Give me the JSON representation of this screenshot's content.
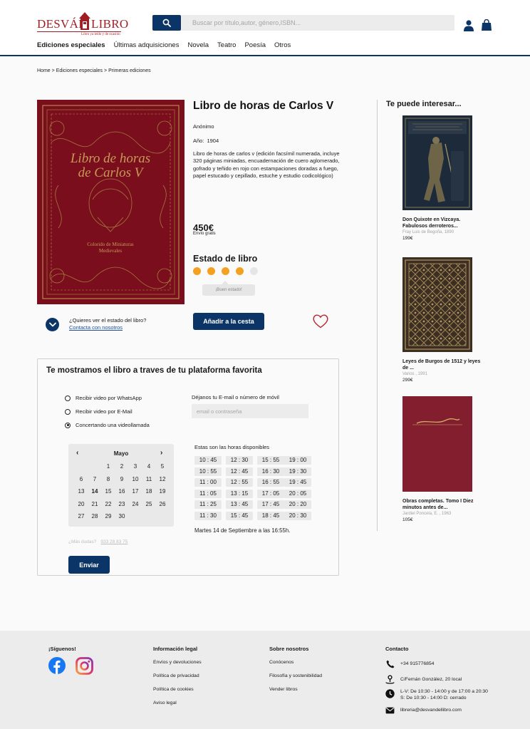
{
  "header": {
    "logo_word1": "DESVÁN",
    "logo_word2": "LIBRO",
    "logo_tagline": "Libro ya leído y de ocasión",
    "search_placeholder": "Buscar por título,autor, género,ISBN...",
    "nav": [
      "Ediciones especiales",
      "Últimas adquisiciones",
      "Novela",
      "Teatro",
      "Poesía",
      "Otros"
    ]
  },
  "breadcrumb": [
    "Home",
    "Ediciones especiales",
    "Primeras ediciones"
  ],
  "product": {
    "title": "Libro de horas de Carlos V",
    "cover_text": [
      "Libro de horas",
      "de Carlos V",
      "Colorido de Miniaturas",
      "Medievales"
    ],
    "author": "Anónimo",
    "year_label": "Año:",
    "year": "1904",
    "description": "Libro de horas de carlos v (edición facsímil numerada, incluye 320 páginas miniadas, encuadernación de cuero aglomerado, gofrado y teñido en rojo con estampaciones   doradas a fuego, papel estucado y cepillado, estuche y    estudio codicológico)",
    "price": "450€",
    "shipping": "Envío gratis",
    "state_title": "Estado de libro",
    "state_rating": 4,
    "state_max": 5,
    "state_tooltip": "¡Buen estado!",
    "ask_question": "¿Quieres ver el estado del libro?",
    "ask_contact": "Contacta con nosotros",
    "add_to_cart": "Añadir a la cesta"
  },
  "sidebar": {
    "title": "Te puede interesar...",
    "books": [
      {
        "title": "Don Quixote en Vizcaya. Fabulosos derroteros...",
        "author": "Fray Luis de Begoña, 1890",
        "price": "199€"
      },
      {
        "title": "Leyes de Burgos de 1512 y leyes de ...",
        "author": "Varios , 1991",
        "price": "299€"
      },
      {
        "title": "Obras completas. Tomo I Diez minutos antes de...",
        "author": "Jardiel Poncela, E. , 1963",
        "price": "105€"
      }
    ]
  },
  "video": {
    "title": "Te mostramos el libro a traves de tu plataforma favorita",
    "options": [
      "Recibir video por WhatsApp",
      "Recibir video por E-Mail",
      "Concertando una videollamada"
    ],
    "selected_option": 2,
    "contact_label": "Déjanos tu  E-mail o número de móvil",
    "contact_placeholder": "email o contraseña",
    "calendar": {
      "prev": "‹",
      "next": "›",
      "month": "Mayo",
      "weeks": [
        [
          "",
          "",
          "1",
          "2",
          "3",
          "4",
          "5"
        ],
        [
          "6",
          "7",
          "8",
          "9",
          "10",
          "11",
          "12"
        ],
        [
          "13",
          "14",
          "15",
          "16",
          "17",
          "18",
          "19"
        ],
        [
          "20",
          "21",
          "22",
          "23",
          "24",
          "25",
          "26"
        ],
        [
          "27",
          "28",
          "29",
          "30",
          "",
          "",
          ""
        ]
      ],
      "selected_day": "14"
    },
    "hours_title": "Estas son las horas disponibles",
    "hours": [
      [
        "10 : 45",
        "12 : 30",
        "15 : 55",
        "19 : 00"
      ],
      [
        "10 : 55",
        "12 : 45",
        "16 : 30",
        "19 : 30"
      ],
      [
        "11 : 00",
        "12 : 55",
        "16 : 55",
        "19 : 45"
      ],
      [
        "11 : 05",
        "13 : 15",
        "17 : 05",
        "20 : 05"
      ],
      [
        "11 : 25",
        "13 : 45",
        "17 : 45",
        "20 : 20"
      ],
      [
        "11 : 30",
        "15 : 45",
        "18 : 45",
        "20 : 30"
      ]
    ],
    "selected_time": "Martes 14 de Septiembre  a las  16:55h.",
    "more_questions": "¿Más dudas?",
    "phone": "933 28 83 75",
    "send": "Enviar"
  },
  "footer": {
    "follow_title": "¡Síguenos!",
    "legal_title": "Información legal",
    "legal_links": [
      "Envíos y devoluciones",
      "Política de privacidad",
      "Política de cookies",
      "Aviso legal"
    ],
    "about_title": "Sobre nosotros",
    "about_links": [
      "Conócenos",
      "Filosofía y sostenibilidad",
      "Vender libros"
    ],
    "contact_title": "Contacto",
    "contact_phone": "+34 915776854",
    "contact_address": "C/Fernán González, 20 local",
    "contact_hours_1": "L-V: De 10:30 - 14:00 y de 17:00 a 20:30",
    "contact_hours_2": "S: De 10:30 - 14:00 D: cerrado",
    "contact_email": "libreria@desvandellibro.com"
  },
  "colors": {
    "brand_navy": "#0b3566",
    "logo_red": "#a11d24",
    "state_orange": "#f4a020",
    "heart_red": "#c0202a"
  }
}
